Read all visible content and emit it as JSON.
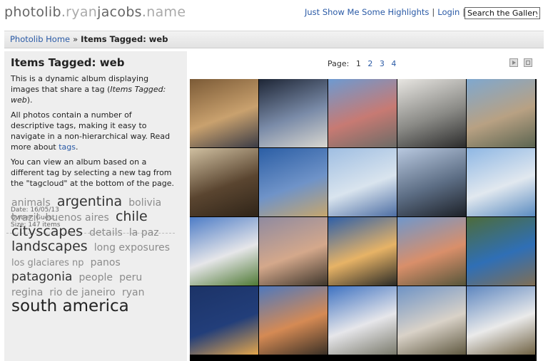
{
  "header": {
    "logo_part1": "photolib",
    "logo_dot1": ".",
    "logo_part2": "ryan",
    "logo_part3": "jacobs",
    "logo_dot2": ".",
    "logo_part4": "name",
    "link_highlights": "Just Show Me Some Highlights",
    "separator": "|",
    "link_login": "Login",
    "search_placeholder": "Search the Gallery"
  },
  "breadcrumb": {
    "home": "Photolib Home",
    "arrow": "»",
    "current": "Items Tagged: web"
  },
  "album": {
    "title": "Items Tagged: web",
    "desc1": "This is a dynamic album displaying images that share a tag (",
    "desc1_em": "Items Tagged: web",
    "desc1_end": ").",
    "desc2": "All photos contain a number of descriptive tags, making it easy to navigate in a non-hierarchical way. Read more about ",
    "desc2_link": "tags",
    "desc2_end": ".",
    "desc3": "You can view an album based on a different tag by selecting a new tag from the \"tagcloud\" at the bottom of the page.",
    "date": "Date: 16/05/13",
    "owner": "Owner: Guest",
    "size": "Size: 147 items"
  },
  "tags": [
    {
      "label": "animals",
      "size": 2
    },
    {
      "label": "argentina",
      "size": 5
    },
    {
      "label": "bolivia",
      "size": 2
    },
    {
      "label": "brazil",
      "size": 2
    },
    {
      "label": "buenos aires",
      "size": 2
    },
    {
      "label": "chile",
      "size": 5
    },
    {
      "label": "cityscapes",
      "size": 5
    },
    {
      "label": "details",
      "size": 2
    },
    {
      "label": "la paz",
      "size": 2
    },
    {
      "label": "landscapes",
      "size": 5
    },
    {
      "label": "long exposures",
      "size": 2
    },
    {
      "label": "los glaciares np",
      "size": 1
    },
    {
      "label": "panos",
      "size": 2
    },
    {
      "label": "patagonia",
      "size": 4
    },
    {
      "label": "people",
      "size": 2
    },
    {
      "label": "peru",
      "size": 2
    },
    {
      "label": "regina",
      "size": 2
    },
    {
      "label": "rio de janeiro",
      "size": 2
    },
    {
      "label": "ryan",
      "size": 2
    },
    {
      "label": "south america",
      "size": 6
    }
  ],
  "pager": {
    "label": "Page:",
    "current": "1",
    "pages": [
      "2",
      "3",
      "4"
    ]
  },
  "thumbnails": [
    {
      "name": "thumb-ship-rigging",
      "colors": [
        "#7b5a36",
        "#c9a16e",
        "#3a3b45"
      ]
    },
    {
      "name": "thumb-obelisk",
      "colors": [
        "#1e2636",
        "#7a8ba8",
        "#d9d7d0"
      ]
    },
    {
      "name": "thumb-casa-rosada",
      "colors": [
        "#6d9ad1",
        "#c77a73",
        "#6b6b66"
      ]
    },
    {
      "name": "thumb-gallery-interior",
      "colors": [
        "#e8e6e2",
        "#8a8a86",
        "#2b2b2b"
      ]
    },
    {
      "name": "thumb-city-aerial",
      "colors": [
        "#7fa8cf",
        "#b8a183",
        "#5b6450"
      ]
    },
    {
      "name": "thumb-wooden-pier",
      "colors": [
        "#d0c0a1",
        "#5a4530",
        "#2f2418"
      ]
    },
    {
      "name": "thumb-harbor-crane",
      "colors": [
        "#2b5ea5",
        "#6f93c8",
        "#c7a66c"
      ]
    },
    {
      "name": "thumb-glacier-front",
      "colors": [
        "#9fbee2",
        "#d9e4ee",
        "#4c6da3"
      ]
    },
    {
      "name": "thumb-photographer-glacier",
      "colors": [
        "#b9c9e0",
        "#5c6d84",
        "#1d2128"
      ]
    },
    {
      "name": "thumb-glacier-lake",
      "colors": [
        "#8eb7e4",
        "#e1e8ef",
        "#5a8bc0"
      ]
    },
    {
      "name": "thumb-fitz-roy-valley",
      "colors": [
        "#4d7cc7",
        "#e6e6e9",
        "#4f7a35"
      ]
    },
    {
      "name": "thumb-mountain-dusk",
      "colors": [
        "#8f8aa0",
        "#d4a88b",
        "#3d352b"
      ]
    },
    {
      "name": "thumb-golden-peaks",
      "colors": [
        "#2e5fa8",
        "#e7b366",
        "#2a2a26"
      ]
    },
    {
      "name": "thumb-fitz-roy-sunrise",
      "colors": [
        "#6f97cc",
        "#d98f6a",
        "#55553a"
      ]
    },
    {
      "name": "thumb-campsite-tent",
      "colors": [
        "#4d6c3a",
        "#2f6fb6",
        "#806f55"
      ]
    },
    {
      "name": "thumb-night-lights",
      "colors": [
        "#1c3367",
        "#223e7a",
        "#e3a54b"
      ]
    },
    {
      "name": "thumb-peaks-orange",
      "colors": [
        "#4e78bd",
        "#d58a54",
        "#3a3026"
      ]
    },
    {
      "name": "thumb-lagoon-peaks",
      "colors": [
        "#3e72c2",
        "#e6e6ea",
        "#7a7a6c"
      ]
    },
    {
      "name": "thumb-laguna-torre",
      "colors": [
        "#6e93c6",
        "#d9d2c8",
        "#5f5840"
      ]
    },
    {
      "name": "thumb-trail-sign",
      "colors": [
        "#5d86c0",
        "#eaeaea",
        "#6f6142"
      ]
    }
  ]
}
